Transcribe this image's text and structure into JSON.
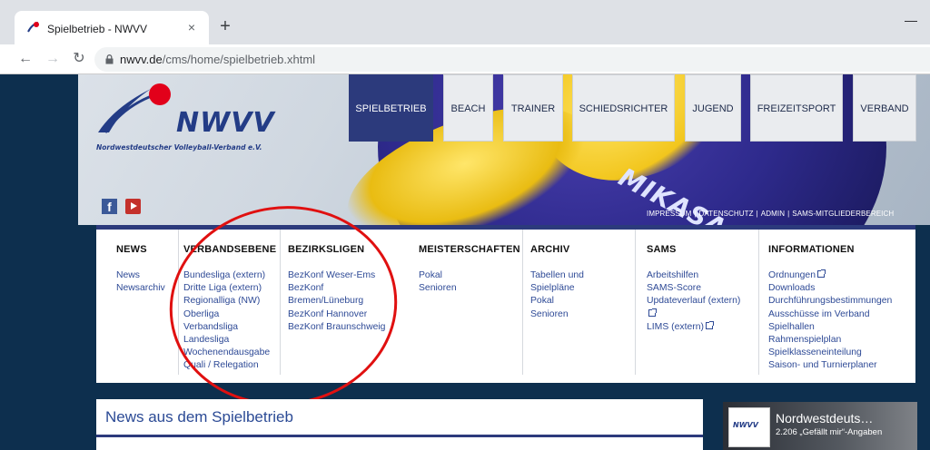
{
  "browser": {
    "tab_title": "Spielbetrieb - NWVV",
    "tab_close": "×",
    "new_tab": "+",
    "window_minimize": "—",
    "url_host": "nwvv.de",
    "url_path": "/cms/home/spielbetrieb.xhtml"
  },
  "header": {
    "logo_name": "NWVV",
    "logo_subtitle": "Nordwestdeutscher Volleyball-Verband e.V.",
    "ball_brand": "MIKASA",
    "nav": [
      "SPIELBETRIEB",
      "BEACH",
      "TRAINER",
      "SCHIEDSRICHTER",
      "JUGEND",
      "FREIZEITSPORT",
      "VERBAND"
    ],
    "active_nav": "SPIELBETRIEB",
    "social_fb": "f",
    "meta_links": [
      "IMPRESSUM",
      "DATENSCHUTZ",
      "ADMIN",
      "SAMS-MITGLIEDERBEREICH"
    ],
    "meta_sep": "|"
  },
  "menu": {
    "news": {
      "heading": "NEWS",
      "items": [
        "News",
        "Newsarchiv"
      ]
    },
    "verbandsebene": {
      "heading": "VERBANDSEBENE",
      "items": [
        "Bundesliga (extern)",
        "Dritte Liga (extern)",
        "Regionalliga (NW)",
        "Oberliga",
        "Verbandsliga",
        "Landesliga",
        "Wochenendausgabe",
        "Quali / Relegation"
      ]
    },
    "bezirksligen": {
      "heading": "BEZIRKSLIGEN",
      "items": [
        "BezKonf Weser-Ems",
        "BezKonf",
        "Bremen/Lüneburg",
        "BezKonf Hannover",
        "BezKonf Braunschweig"
      ]
    },
    "meisterschaften": {
      "heading": "MEISTERSCHAFTEN",
      "items": [
        "Pokal",
        "Senioren"
      ]
    },
    "archiv": {
      "heading": "ARCHIV",
      "items": [
        "Tabellen und",
        "Spielpläne",
        "Pokal",
        "Senioren"
      ]
    },
    "sams": {
      "heading": "SAMS",
      "items": [
        "Arbeitshilfen",
        "SAMS-Score",
        "Updateverlauf (extern)",
        "",
        "LIMS (extern)"
      ]
    },
    "informationen": {
      "heading": "INFORMATIONEN",
      "items": [
        "Ordnungen",
        "Downloads",
        "Durchführungsbestimmungen",
        "Ausschüsse im Verband",
        "Spielhallen",
        "Rahmenspielplan",
        "Spielklasseneinteilung",
        "Saison- und Turnierplaner"
      ]
    }
  },
  "news_section": {
    "title": "News aus dem Spielbetrieb"
  },
  "fb_widget": {
    "page_name": "Nordwestdeuts…",
    "likes": "2.206 „Gefällt mir“-Angaben",
    "thumb_text": "NWVV"
  },
  "colors": {
    "brand_navy": "#2c3a7c",
    "link_blue": "#2e4a96",
    "logo_red": "#e2001a",
    "annotation_red": "#e01010"
  }
}
